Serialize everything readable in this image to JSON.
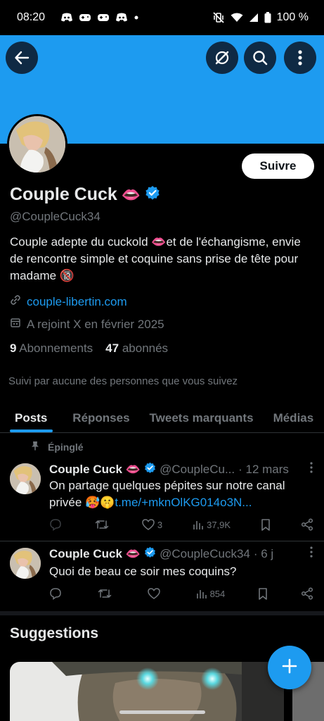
{
  "status_bar": {
    "time": "08:20",
    "battery": "100 %"
  },
  "profile": {
    "display_name": "Couple Cuck",
    "name_emoji": "👄",
    "handle": "@CoupleCuck34",
    "bio": "Couple adepte du cuckold 👄et de l'échangisme, envie de rencontre simple et coquine sans prise de tête pour madame 🔞",
    "website": "couple-libertin.com",
    "joined": "A rejoint X en février 2025",
    "following_count": "9",
    "following_label": "Abonnements",
    "followers_count": "47",
    "followers_label": "abonnés",
    "followed_by": "Suivi par aucune des personnes que vous suivez",
    "follow_label": "Suivre"
  },
  "tabs": [
    {
      "label": "Posts",
      "active": true
    },
    {
      "label": "Réponses",
      "active": false
    },
    {
      "label": "Tweets marquants",
      "active": false
    },
    {
      "label": "Médias",
      "active": false
    }
  ],
  "pinned_label": "Épinglé",
  "tweets": [
    {
      "name": "Couple Cuck",
      "emoji": "👄",
      "handle": "@CoupleCu...",
      "time": "· 12 mars",
      "text_before": "On partage quelques pépites sur notre canal privée 🥵🤫",
      "text_link": "t.me/+mknOlKG014o3N...",
      "replies": "",
      "retweets": "",
      "likes": "3",
      "views": "37,9K"
    },
    {
      "name": "Couple Cuck",
      "emoji": "👄",
      "handle": "@CoupleCuck34",
      "time": "· 6 j",
      "text_before": "Quoi de beau ce soir mes coquins?",
      "text_link": "",
      "replies": "",
      "retweets": "",
      "likes": "",
      "views": "854"
    }
  ],
  "suggestions_title": "Suggestions",
  "colors": {
    "accent": "#1d9bf0",
    "banner": "#1d9bf0",
    "background": "#000000",
    "muted": "#71767b"
  }
}
